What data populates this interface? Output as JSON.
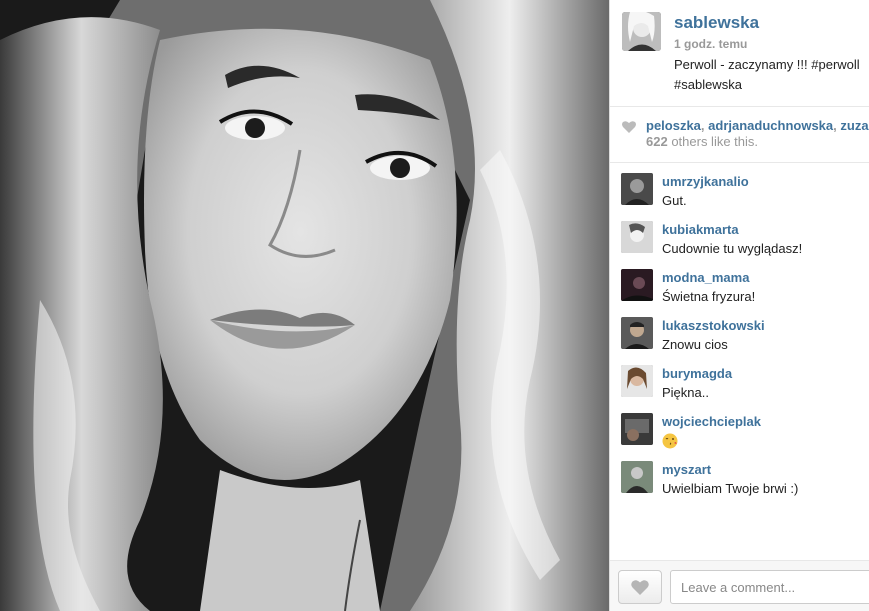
{
  "post": {
    "username": "sablewska",
    "time": "1 godz. temu",
    "caption": "Perwoll - zaczynamy !!! #perwoll\n#sablewska"
  },
  "likes": {
    "likers": [
      "peloszka",
      "adrjanaduchnowska",
      "zuza"
    ],
    "separator": ", ",
    "count": "622",
    "suffix": " others like this."
  },
  "comments": [
    {
      "user": "umrzyjkanalio",
      "text": "Gut."
    },
    {
      "user": "kubiakmarta",
      "text": "Cudownie tu wyglądasz!"
    },
    {
      "user": "modna_mama",
      "text": "Świetna fryzura!"
    },
    {
      "user": "lukaszstokowski",
      "text": "Znowu cios"
    },
    {
      "user": "burymagda",
      "text": "Piękna.."
    },
    {
      "user": "wojciechcieplak",
      "text": "",
      "emoji": "kissing-face-icon"
    },
    {
      "user": "myszart",
      "text": "Uwielbiam Twoje brwi :)"
    }
  ],
  "footer": {
    "comment_placeholder": "Leave a comment..."
  },
  "colors": {
    "link_blue": "#3f729b",
    "muted": "#999999",
    "border": "#e8e8e8"
  }
}
